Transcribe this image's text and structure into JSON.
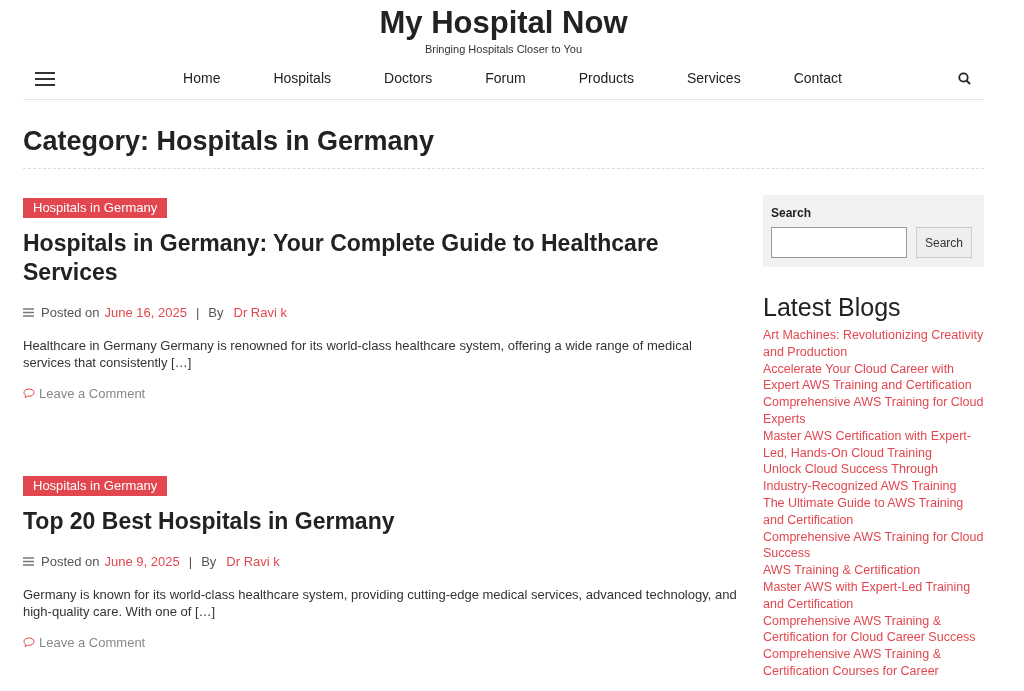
{
  "site": {
    "title": "My Hospital Now",
    "tagline": "Bringing Hospitals Closer to You"
  },
  "nav": [
    "Home",
    "Hospitals",
    "Doctors",
    "Forum",
    "Products",
    "Services",
    "Contact"
  ],
  "page_title": "Category: Hospitals in Germany",
  "posts": [
    {
      "category": "Hospitals in Germany",
      "title": "Hospitals in Germany: Your Complete Guide to Healthcare Services",
      "posted_label": "Posted on",
      "date": "June 16, 2025",
      "separator": "|",
      "by_label": "By",
      "author": "Dr Ravi k",
      "excerpt": "Healthcare in Germany Germany is renowned for its world-class healthcare system, offering a wide range of medical services that consistently […]",
      "comment_link": "Leave a Comment"
    },
    {
      "category": "Hospitals in Germany",
      "title": "Top 20 Best Hospitals in Germany",
      "posted_label": "Posted on",
      "date": "June 9, 2025",
      "separator": "|",
      "by_label": "By",
      "author": "Dr Ravi k",
      "excerpt": "Germany is known for its world-class healthcare system, providing cutting-edge medical services, advanced technology, and high-quality care. With one of […]",
      "comment_link": "Leave a Comment"
    }
  ],
  "sidebar": {
    "search": {
      "label": "Search",
      "button": "Search"
    },
    "latest_blogs": {
      "heading": "Latest Blogs",
      "items": [
        "Art Machines: Revolutionizing Creativity and Production",
        "Accelerate Your Cloud Career with Expert AWS Training and Certification",
        "Comprehensive AWS Training for Cloud Experts",
        "Master AWS Certification with Expert-Led, Hands-On Cloud Training",
        "Unlock Cloud Success Through Industry-Recognized AWS Training",
        "The Ultimate Guide to AWS Training and Certification",
        "Comprehensive AWS Training for Cloud Success",
        "AWS Training & Certification",
        "Master AWS with Expert-Led Training and Certification",
        "Comprehensive AWS Training & Certification for Cloud Career Success",
        "Comprehensive AWS Training & Certification Courses for Career"
      ]
    }
  }
}
